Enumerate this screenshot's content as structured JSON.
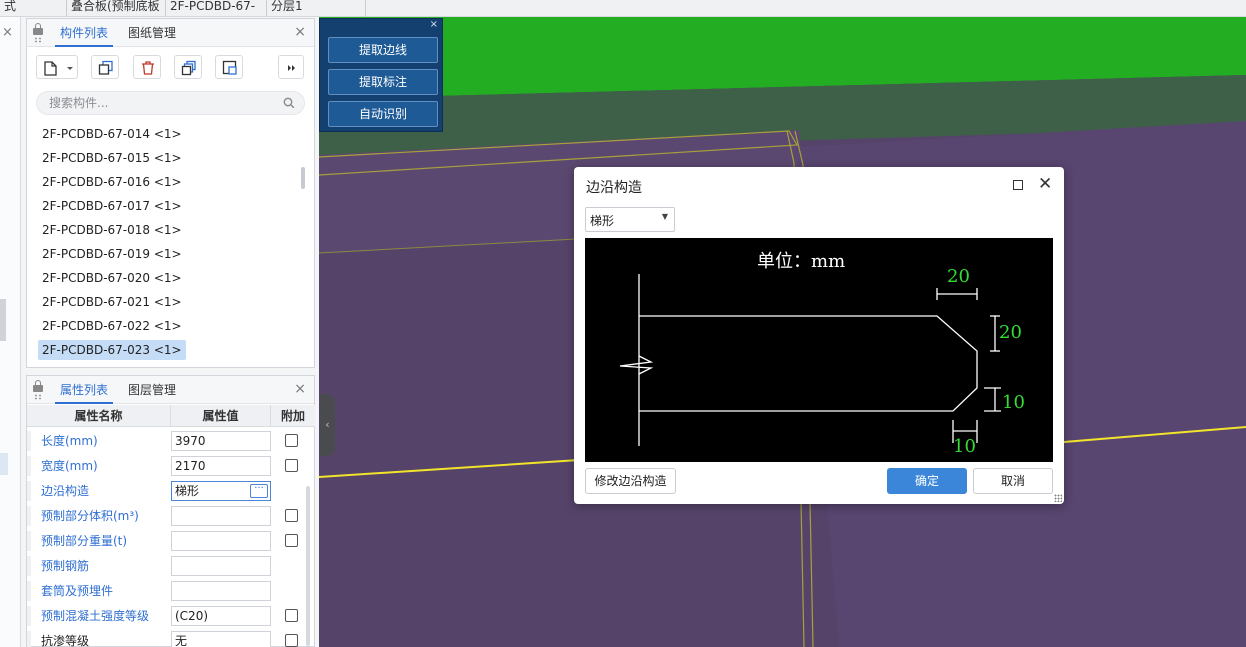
{
  "topbar": {
    "seg1": "式",
    "seg2": "叠合板(预制底板",
    "seg3": "2F-PCDBD-67-",
    "seg4": "分层1"
  },
  "component_panel": {
    "tabs": [
      "构件列表",
      "图纸管理"
    ],
    "search_placeholder": "搜索构件...",
    "items": [
      "2F-PCDBD-67-014 <1>",
      "2F-PCDBD-67-015 <1>",
      "2F-PCDBD-67-016 <1>",
      "2F-PCDBD-67-017 <1>",
      "2F-PCDBD-67-018 <1>",
      "2F-PCDBD-67-019 <1>",
      "2F-PCDBD-67-020 <1>",
      "2F-PCDBD-67-021 <1>",
      "2F-PCDBD-67-022 <1>",
      "2F-PCDBD-67-023 <1>"
    ],
    "selected_index": 9
  },
  "property_panel": {
    "tabs": [
      "属性列表",
      "图层管理"
    ],
    "headers": [
      "属性名称",
      "属性值",
      "附加"
    ],
    "rows": [
      {
        "name": "长度(mm)",
        "value": "3970",
        "checkbox": true
      },
      {
        "name": "宽度(mm)",
        "value": "2170",
        "checkbox": true
      },
      {
        "name": "边沿构造",
        "value": "梯形",
        "checkbox": false
      },
      {
        "name": "预制部分体积(m³)",
        "value": "",
        "checkbox": true
      },
      {
        "name": "预制部分重量(t)",
        "value": "",
        "checkbox": true
      },
      {
        "name": "预制钢筋",
        "value": "",
        "checkbox": false
      },
      {
        "name": "套筒及预埋件",
        "value": "",
        "checkbox": false
      },
      {
        "name": "预制混凝土强度等级",
        "value": "(C20)",
        "checkbox": true
      },
      {
        "name": "抗渗等级",
        "value": "无",
        "checkbox": true
      }
    ],
    "more_button": "···"
  },
  "toolbox": {
    "buttons": [
      "提取边线",
      "提取标注",
      "自动识别"
    ],
    "close": "×"
  },
  "dialog": {
    "title": "边沿构造",
    "select_value": "梯形",
    "drawing": {
      "unit": "单位：mm",
      "dims": [
        "20",
        "20",
        "10",
        "10"
      ]
    },
    "modify_button": "修改边沿构造",
    "ok_button": "确定",
    "cancel_button": "取消"
  },
  "colors": {
    "accent": "#2f6fd2",
    "primary_button": "#3b86d8",
    "viewport_purple": "#56436a",
    "viewport_green": "#22ad22",
    "dimension_green": "#33dd33"
  }
}
